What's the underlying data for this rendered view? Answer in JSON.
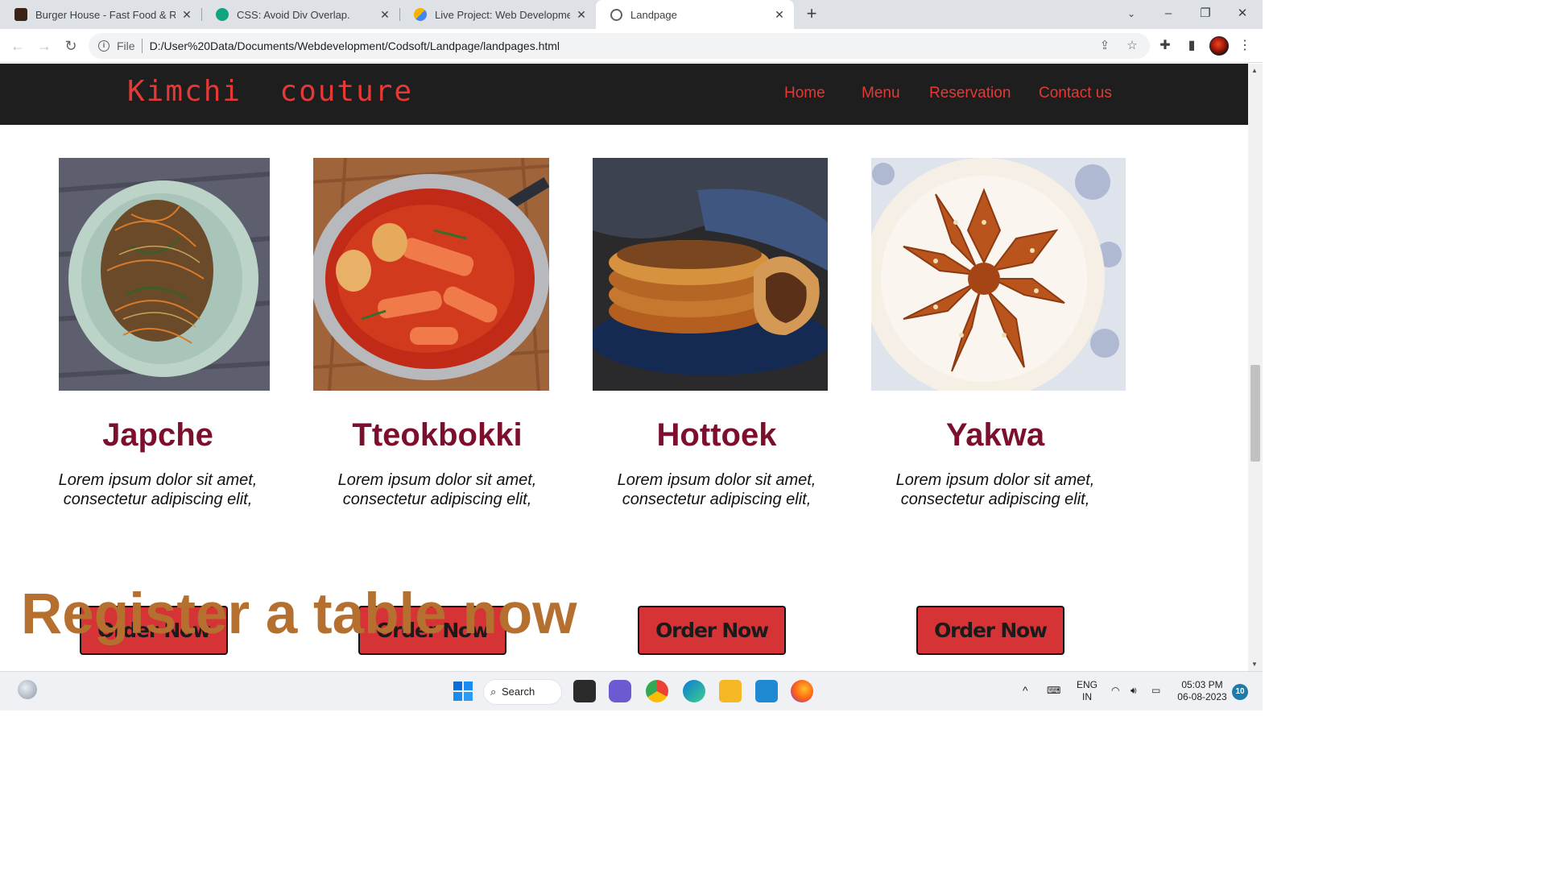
{
  "browser": {
    "tabs": [
      {
        "title": "Burger House - Fast Food & Rest",
        "active": false
      },
      {
        "title": "CSS: Avoid Div Overlap.",
        "active": false
      },
      {
        "title": "Live Project: Web Development -",
        "active": false
      },
      {
        "title": "Landpage",
        "active": true
      }
    ],
    "address": {
      "scheme": "File",
      "url": "D:/User%20Data/Documents/Webdevelopment/Codsoft/Landpage/landpages.html"
    }
  },
  "site": {
    "brand": "Kimchi  couture",
    "nav": [
      "Home",
      "Menu",
      "Reservation",
      "Contact us"
    ],
    "dishes": [
      {
        "name": "Japche",
        "description": "Lorem ipsum dolor sit amet, consectetur adipiscing elit,",
        "button": "Order Now",
        "image": "japchae-noodles-photo"
      },
      {
        "name": "Tteokbokki",
        "description": "Lorem ipsum dolor sit amet, consectetur adipiscing elit,",
        "button": "Order Now",
        "image": "tteokbokki-pot-photo"
      },
      {
        "name": "Hottoek",
        "description": "Lorem ipsum dolor sit amet, consectetur adipiscing elit,",
        "button": "Order Now",
        "image": "hotteok-pancakes-photo"
      },
      {
        "name": "Yakwa",
        "description": "Lorem ipsum dolor sit amet, consectetur adipiscing elit,",
        "button": "Order Now",
        "image": "yakwa-cookies-photo"
      }
    ],
    "register_heading": "Register a table now",
    "colors": {
      "nav_bg": "#1e1e1e",
      "accent_red": "#e53935",
      "dish_title": "#7b0f2c",
      "button_bg": "#d63336",
      "register": "#b5702f"
    }
  },
  "taskbar": {
    "search_label": "Search",
    "language": "ENG",
    "region": "IN",
    "time": "05:03 PM",
    "date": "06-08-2023",
    "notification_count": "10"
  }
}
